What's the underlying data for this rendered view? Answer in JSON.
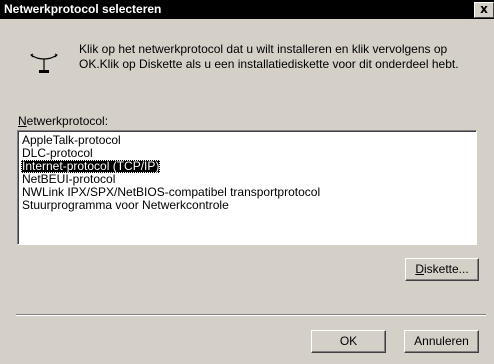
{
  "window": {
    "title": "Netwerkprotocol selecteren",
    "close_glyph": "x"
  },
  "intro": {
    "icon": "network-protocol-icon",
    "text": "Klik op het netwerkprotocol dat u wilt installeren en klik vervolgens op OK.Klik op Diskette als u een installatiediskette voor dit onderdeel hebt."
  },
  "protocol_list": {
    "label_accel": "N",
    "label_rest": "etwerkprotocol:",
    "items": [
      {
        "label": "AppleTalk-protocol",
        "selected": false
      },
      {
        "label": "DLC-protocol",
        "selected": false
      },
      {
        "label": "Internet-protocol (TCP/IP)",
        "selected": true
      },
      {
        "label": "NetBEUI-protocol",
        "selected": false
      },
      {
        "label": "NWLink IPX/SPX/NetBIOS-compatibel transportprotocol",
        "selected": false
      },
      {
        "label": "Stuurprogramma voor Netwerkcontrole",
        "selected": false
      }
    ]
  },
  "buttons": {
    "disk_accel": "D",
    "disk_rest": "iskette...",
    "ok": "OK",
    "cancel": "Annuleren"
  }
}
